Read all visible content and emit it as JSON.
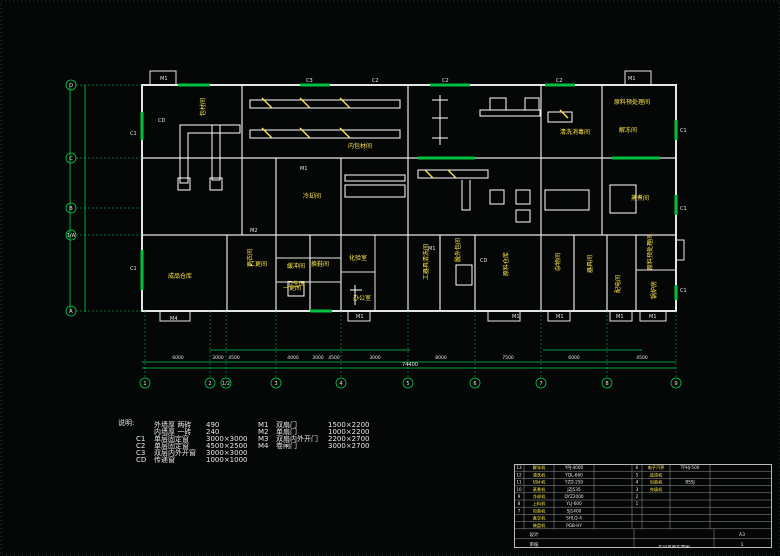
{
  "colors": {
    "background": "#050606",
    "wall": "#e6e6e6",
    "dimension_line": "#00d050",
    "axis_bubble": "#00d050",
    "room_label": "#ffe94a",
    "partition": "#c8c8c8",
    "equipment": "#ffffff",
    "green_window": "#00c040",
    "duct": "#ffffff"
  },
  "rooms": [
    {
      "id": "r1",
      "label": "包材间"
    },
    {
      "id": "r2",
      "label": "内包材间"
    },
    {
      "id": "r3",
      "label": "冷却间"
    },
    {
      "id": "r4",
      "label": "成品仓库"
    },
    {
      "id": "r5",
      "label": "更衣间"
    },
    {
      "id": "r6",
      "label": "二更间"
    },
    {
      "id": "r7",
      "label": "缓冲间"
    },
    {
      "id": "r8",
      "label": "换鞋间"
    },
    {
      "id": "r9",
      "label": "化验室"
    },
    {
      "id": "r10",
      "label": "一更间"
    },
    {
      "id": "r11",
      "label": "卫生间"
    },
    {
      "id": "r12",
      "label": "办公室"
    },
    {
      "id": "r13",
      "label": "工器具清洗间"
    },
    {
      "id": "r14",
      "label": "脱外包间"
    },
    {
      "id": "r15",
      "label": "原料仓库"
    },
    {
      "id": "r16",
      "label": "杂物间"
    },
    {
      "id": "r17",
      "label": "器具间"
    },
    {
      "id": "r18",
      "label": "配电间"
    },
    {
      "id": "r19",
      "label": "锅炉房"
    },
    {
      "id": "r20",
      "label": "原料预处理间"
    },
    {
      "id": "r21",
      "label": "解冻间"
    },
    {
      "id": "r22",
      "label": "清洗消毒间"
    },
    {
      "id": "r23",
      "label": "蒸煮间"
    },
    {
      "id": "r24",
      "label": "原料预处理间"
    }
  ],
  "axes_numbers": [
    "1",
    "2",
    "1/2",
    "3",
    "4",
    "5",
    "6",
    "7",
    "8",
    "9"
  ],
  "axes_letters": [
    "D",
    "C",
    "B",
    "1/A",
    "A"
  ],
  "dimensions_overall": "74400",
  "dimensions_segment": [
    "6000",
    "3000",
    "4500",
    "4000",
    "3000",
    "4500",
    "3000",
    "8000",
    "7500",
    "6000",
    "4500"
  ],
  "notes": {
    "heading": "说明:",
    "lines_left": [
      {
        "code": "",
        "desc": "外墙厚 两砖",
        "val": "490"
      },
      {
        "code": "",
        "desc": "内墙厚 一砖",
        "val": "240"
      },
      {
        "code": "C1",
        "desc": "单层固定窗",
        "val": "3000×3000"
      },
      {
        "code": "C2",
        "desc": "单层固定窗",
        "val": "4500×2500"
      },
      {
        "code": "C3",
        "desc": "双层内外开窗",
        "val": "3000×3000"
      },
      {
        "code": "CD",
        "desc": "传递窗",
        "val": "1000×1000"
      }
    ],
    "lines_right": [
      {
        "code": "M1",
        "desc": "双扇门",
        "val": "1500×2200"
      },
      {
        "code": "M2",
        "desc": "单扇门",
        "val": "1000×2200"
      },
      {
        "code": "M3",
        "desc": "双扇内外开门",
        "val": "2200×2700"
      },
      {
        "code": "M4",
        "desc": "卷闸门",
        "val": "3000×2700"
      }
    ]
  },
  "title_block": {
    "table_rows": [
      {
        "no": "13",
        "name": "解冻机",
        "model": "YPJ-4000",
        "no2": "6",
        "name2": "电子汽秤",
        "model2": "TPHJ-500"
      },
      {
        "no": "12",
        "name": "清洗机",
        "model": "YQL-660",
        "no2": "5",
        "name2": "盐渍机",
        "model2": ""
      },
      {
        "no": "11",
        "name": "切片机",
        "model": "YZD-250",
        "no2": "4",
        "name2": "包装机",
        "model2": "BSSJ"
      },
      {
        "no": "10",
        "name": "蒸煮机",
        "model": "JZJ535",
        "no2": "3",
        "name2": "充填机",
        "model2": ""
      },
      {
        "no": "9",
        "name": "冷却机",
        "model": "DYZ2000",
        "no2": "2",
        "name2": "",
        "model2": ""
      },
      {
        "no": "8",
        "name": "上料机",
        "model": "YLJ-600",
        "no2": "1",
        "name2": "",
        "model2": ""
      },
      {
        "no": "7",
        "name": "包装机",
        "model": "SJ1400",
        "no2": "",
        "name2": "",
        "model2": ""
      },
      {
        "no": "",
        "name": "真空机",
        "model": "SHLQ-4",
        "no2": "",
        "name2": "",
        "model2": ""
      },
      {
        "no": "",
        "name": "装盘机",
        "model": "PGB-HY",
        "no2": "",
        "name2": "",
        "model2": ""
      }
    ],
    "drawing_name": "车间平面布置图",
    "scale_label": "A3",
    "sheet_no": "1",
    "designer_label": "设计",
    "reviewer_label": "审核"
  }
}
